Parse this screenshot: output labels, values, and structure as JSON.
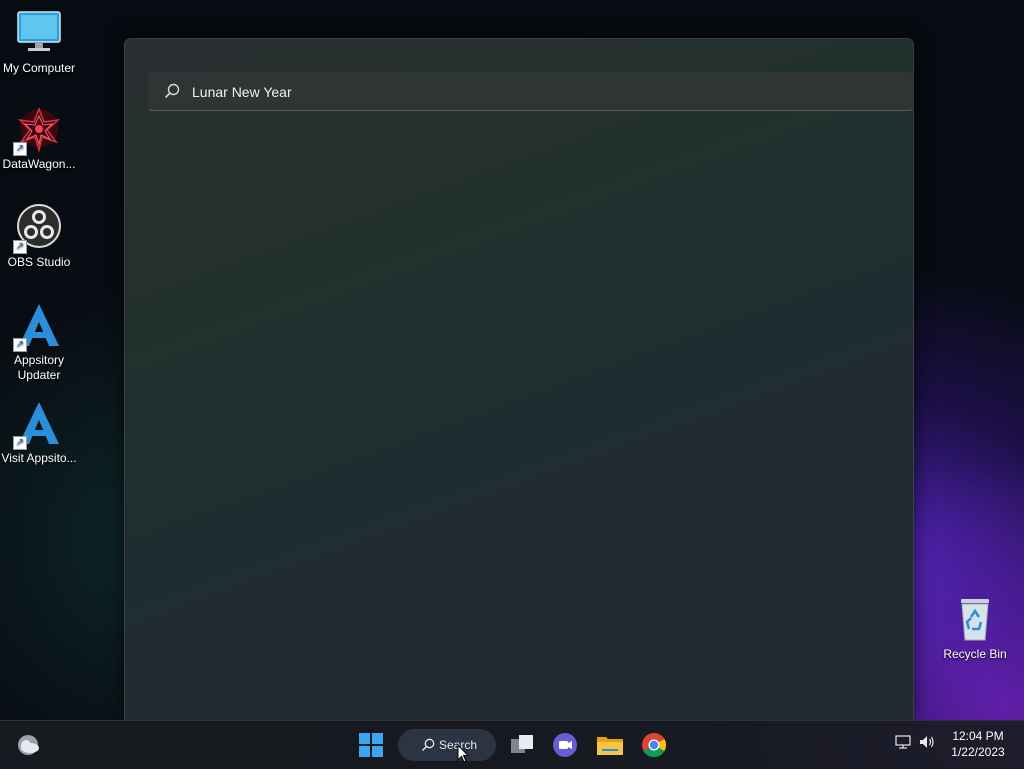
{
  "desktop": {
    "icons": [
      {
        "label": "My Computer",
        "icon": "monitor-icon"
      },
      {
        "label": "DataWagon...",
        "icon": "datawagon-icon"
      },
      {
        "label": "OBS Studio",
        "icon": "obs-icon"
      },
      {
        "label": "Appsitory Updater",
        "icon": "appsitory-icon"
      },
      {
        "label": "Visit Appsito...",
        "icon": "appsitory-icon"
      },
      {
        "label": "Recycle Bin",
        "icon": "recycle-bin-icon"
      }
    ]
  },
  "search_panel": {
    "query": "Lunar New Year",
    "icon": "search-icon"
  },
  "taskbar": {
    "search_label": "Search",
    "apps": [
      "weather-icon",
      "start-icon",
      "task-view-icon",
      "chat-icon",
      "file-explorer-icon",
      "chrome-icon"
    ],
    "tray": {
      "network_icon": "network-icon",
      "volume_icon": "volume-icon",
      "time": "12:04 PM",
      "date": "1/22/2023"
    }
  },
  "colors": {
    "accent": "#0078d4",
    "wallpaper_glow": "#5c28d2"
  }
}
